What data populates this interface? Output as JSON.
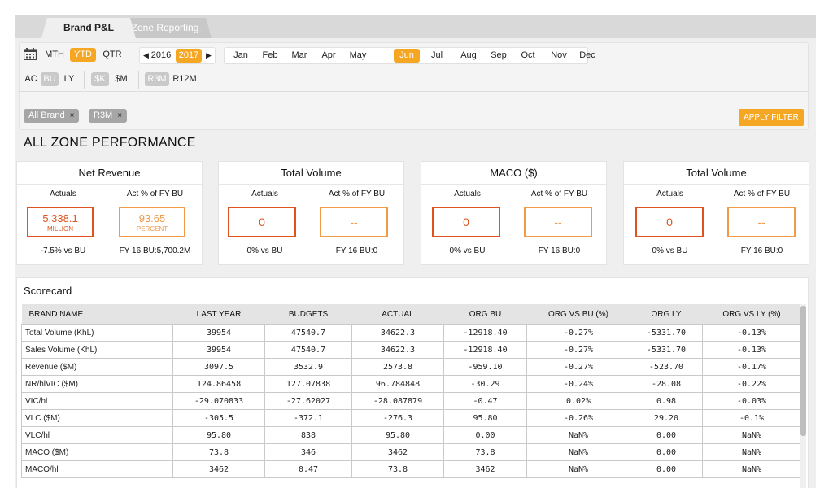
{
  "tabs": [
    {
      "label": "Brand P&L"
    },
    {
      "label": "Zone Reporting"
    }
  ],
  "filters": {
    "period": {
      "mth": "MTH",
      "ytd": "YTD",
      "qtr": "QTR"
    },
    "years": {
      "prev": "2016",
      "current": "2017"
    },
    "months": [
      "Jan",
      "Feb",
      "Mar",
      "Apr",
      "May",
      "Jun",
      "Jul",
      "Aug",
      "Sep",
      "Oct",
      "Nov",
      "Dec"
    ],
    "selected_month": "Jun",
    "compare": {
      "ac": "AC",
      "bu": "BU",
      "ly": "LY"
    },
    "units": {
      "k": "$K",
      "m": "$M"
    },
    "rolling": {
      "r3m": "R3M",
      "r12m": "R12M"
    },
    "chips": [
      {
        "label": "All Brand",
        "remove": "×"
      },
      {
        "label": "R3M",
        "remove": "×"
      }
    ],
    "apply_label": "APPLY FILTER",
    "accent_color": "#f5a623"
  },
  "heading": "ALL ZONE PERFORMANCE",
  "kpi_cards": [
    {
      "title": "Net Revenue",
      "actuals_label": "Actuals",
      "pct_label": "Act % of FY BU",
      "actual_value": "5,338.1",
      "actual_unit": "MILLION",
      "pct_value": "93.65",
      "pct_unit": "PERCENT",
      "vs_bu": "-7.5% vs BU",
      "fy_bu": "FY 16 BU:5,700.2M"
    },
    {
      "title": "Total Volume",
      "actuals_label": "Actuals",
      "pct_label": "Act % of FY BU",
      "actual_value": "0",
      "pct_value": "--",
      "vs_bu": "0% vs BU",
      "fy_bu": "FY 16 BU:0"
    },
    {
      "title": "MACO ($)",
      "actuals_label": "Actuals",
      "pct_label": "Act % of FY BU",
      "actual_value": "0",
      "pct_value": "--",
      "vs_bu": "0% vs BU",
      "fy_bu": "FY 16 BU:0"
    },
    {
      "title": "Total Volume",
      "actuals_label": "Actuals",
      "pct_label": "Act % of FY BU",
      "actual_value": "0",
      "pct_value": "--",
      "vs_bu": "0% vs BU",
      "fy_bu": "FY 16 BU:0"
    }
  ],
  "scorecard": {
    "title": "Scorecard",
    "headers": [
      "BRAND NAME",
      "LAST YEAR",
      "BUDGETS",
      "ACTUAL",
      "ORG BU",
      "ORG VS BU (%)",
      "ORG LY",
      "ORG VS LY (%)"
    ],
    "rows": [
      [
        "Total Volume (KhL)",
        "39954",
        "47540.7",
        "34622.3",
        "-12918.40",
        "-0.27%",
        "-5331.70",
        "-0.13%"
      ],
      [
        "Sales Volume (KhL)",
        "39954",
        "47540.7",
        "34622.3",
        "-12918.40",
        "-0.27%",
        "-5331.70",
        "-0.13%"
      ],
      [
        "Revenue ($M)",
        "3097.5",
        "3532.9",
        "2573.8",
        "-959.10",
        "-0.27%",
        "-523.70",
        "-0.17%"
      ],
      [
        "NR/hlVIC ($M)",
        "124.86458",
        "127.07838",
        "96.784848",
        "-30.29",
        "-0.24%",
        "-28.08",
        "-0.22%"
      ],
      [
        "VIC/hl",
        "-29.070833",
        "-27.62027",
        "-28.087879",
        "-0.47",
        "0.02%",
        "0.98",
        "-0.03%"
      ],
      [
        "VLC ($M)",
        "-305.5",
        "-372.1",
        "-276.3",
        "95.80",
        "-0.26%",
        "29.20",
        "-0.1%"
      ],
      [
        "VLC/hl",
        "95.80",
        "838",
        "95.80",
        "0.00",
        "NaN%",
        "0.00",
        "NaN%"
      ],
      [
        "MACO ($M)",
        "73.8",
        "346",
        "3462",
        "73.8",
        "NaN%",
        "0.00",
        "NaN%"
      ],
      [
        "MACO/hl",
        "3462",
        "0.47",
        "73.8",
        "3462",
        "NaN%",
        "0.00",
        "NaN%"
      ]
    ]
  }
}
